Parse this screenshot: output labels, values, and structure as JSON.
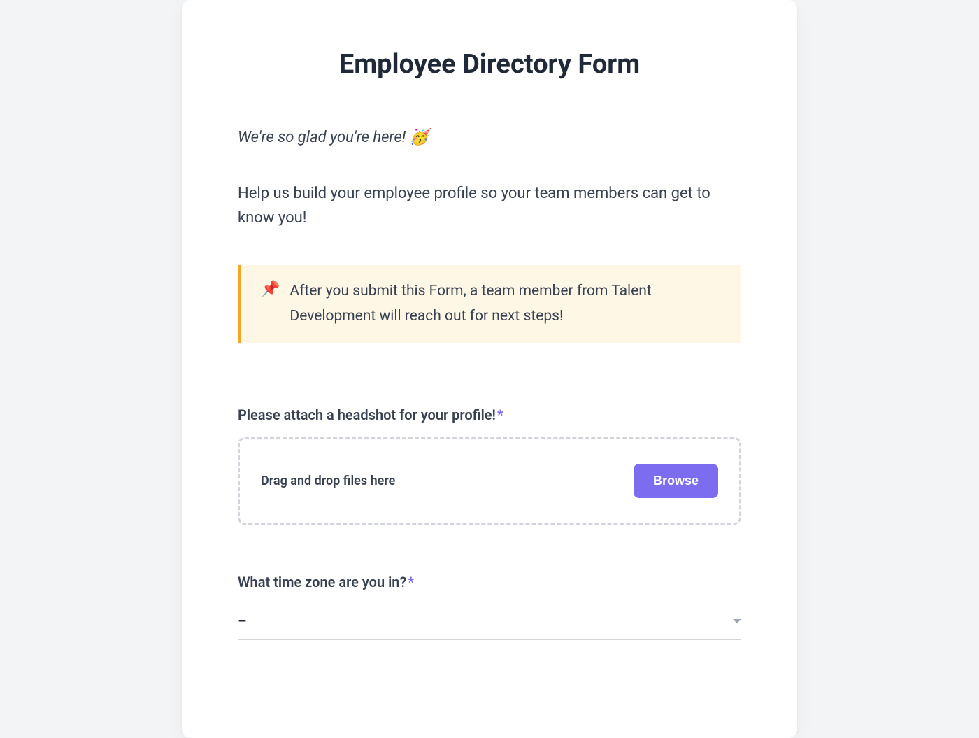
{
  "form": {
    "title": "Employee Directory Form",
    "greeting": "We're so glad you're here! 🥳",
    "intro": "Help us build your employee profile so your team members can get to know you!",
    "callout": {
      "icon": "📌",
      "text": "After you submit this Form, a team member from Talent Development will reach out for next steps!"
    },
    "fields": {
      "headshot": {
        "label": "Please attach a headshot for your profile!",
        "required_marker": "*",
        "dropzone_text": "Drag and drop files here",
        "browse_label": "Browse"
      },
      "timezone": {
        "label": "What time zone are you in?",
        "required_marker": "*",
        "selected_value": "–"
      }
    }
  },
  "colors": {
    "accent": "#7c6cf0",
    "callout_bg": "#fef7e6",
    "callout_border": "#f6a623"
  }
}
